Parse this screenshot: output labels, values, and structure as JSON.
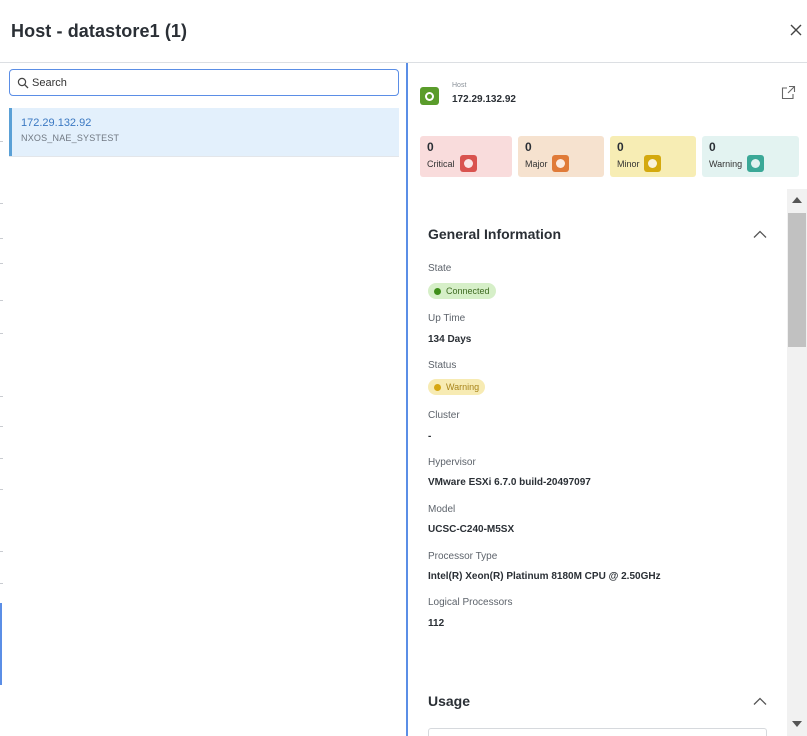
{
  "header": {
    "title": "Host - datastore1 (1)",
    "close_icon": "close-icon"
  },
  "search": {
    "placeholder": "Search",
    "value": ""
  },
  "list": {
    "items": [
      {
        "title": "172.29.132.92",
        "subtitle": "NXOS_NAE_SYSTEST"
      }
    ]
  },
  "detail": {
    "type_label": "Host",
    "name": "172.29.132.92",
    "icon": "host-icon",
    "open_icon": "external-link-icon",
    "counts": [
      {
        "label": "Critical",
        "value": "0",
        "color": "#d9534f"
      },
      {
        "label": "Major",
        "value": "0",
        "color": "#e07b39"
      },
      {
        "label": "Minor",
        "value": "0",
        "color": "#d4a90e"
      },
      {
        "label": "Warning",
        "value": "0",
        "color": "#3ba897"
      }
    ],
    "general": {
      "title": "General Information",
      "state_label": "State",
      "state_value": "Connected",
      "uptime_label": "Up Time",
      "uptime_value": "134 Days",
      "status_label": "Status",
      "status_value": "Warning",
      "cluster_label": "Cluster",
      "cluster_value": "-",
      "hypervisor_label": "Hypervisor",
      "hypervisor_value": "VMware ESXi 6.7.0 build-20497097",
      "model_label": "Model",
      "model_value": "UCSC-C240-M5SX",
      "processor_type_label": "Processor Type",
      "processor_type_value": "Intel(R) Xeon(R) Platinum 8180M CPU @ 2.50GHz",
      "logical_processors_label": "Logical Processors",
      "logical_processors_value": "112"
    },
    "usage": {
      "title": "Usage"
    }
  },
  "colors": {
    "accent": "#5b8ee6",
    "selected_row": "#e3f0fc",
    "connected": "#3f8f1a",
    "warning": "#d6a713"
  }
}
